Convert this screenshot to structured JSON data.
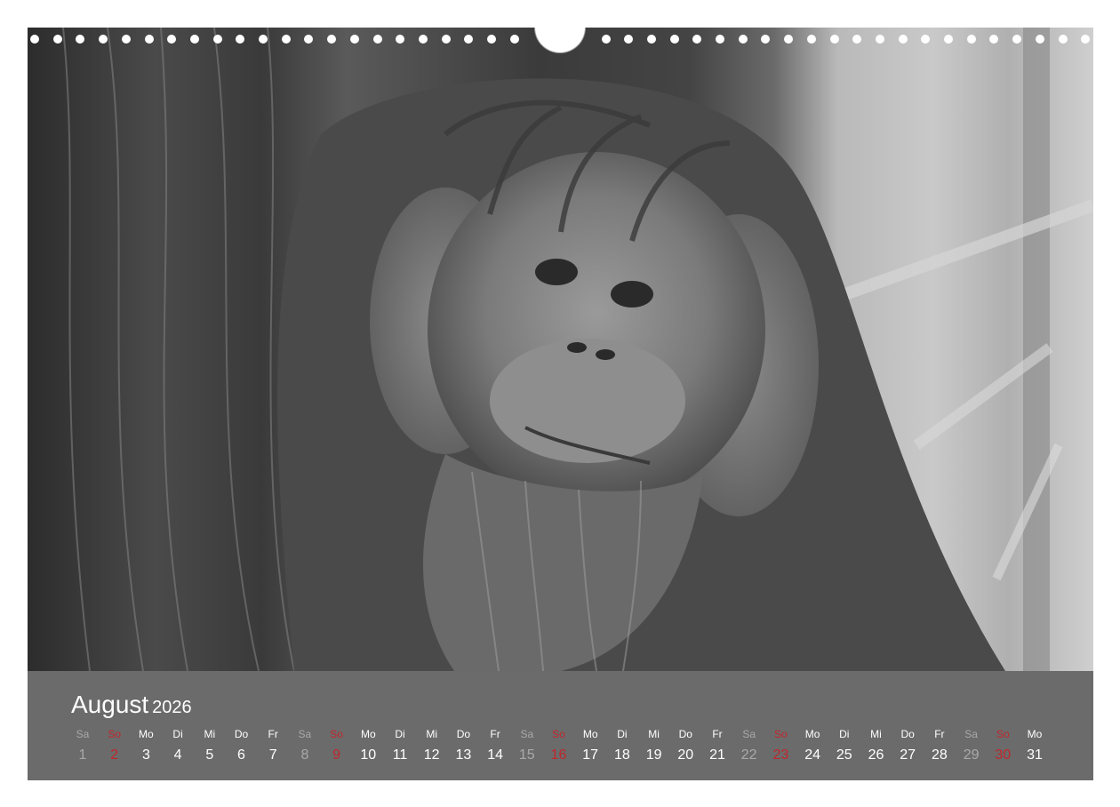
{
  "calendar": {
    "month": "August",
    "year": "2026",
    "photo_subject": "",
    "colors": {
      "bar_background": "#6b6b6b",
      "weekday_text": "#ffffff",
      "saturday_text": "#a9a9a9",
      "sunday_text": "#c0272d"
    },
    "days": [
      {
        "dn": "Sa",
        "n": "1",
        "t": "sat"
      },
      {
        "dn": "So",
        "n": "2",
        "t": "sun"
      },
      {
        "dn": "Mo",
        "n": "3",
        "t": "wd"
      },
      {
        "dn": "Di",
        "n": "4",
        "t": "wd"
      },
      {
        "dn": "Mi",
        "n": "5",
        "t": "wd"
      },
      {
        "dn": "Do",
        "n": "6",
        "t": "wd"
      },
      {
        "dn": "Fr",
        "n": "7",
        "t": "wd"
      },
      {
        "dn": "Sa",
        "n": "8",
        "t": "sat"
      },
      {
        "dn": "So",
        "n": "9",
        "t": "sun"
      },
      {
        "dn": "Mo",
        "n": "10",
        "t": "wd"
      },
      {
        "dn": "Di",
        "n": "11",
        "t": "wd"
      },
      {
        "dn": "Mi",
        "n": "12",
        "t": "wd"
      },
      {
        "dn": "Do",
        "n": "13",
        "t": "wd"
      },
      {
        "dn": "Fr",
        "n": "14",
        "t": "wd"
      },
      {
        "dn": "Sa",
        "n": "15",
        "t": "sat"
      },
      {
        "dn": "So",
        "n": "16",
        "t": "sun"
      },
      {
        "dn": "Mo",
        "n": "17",
        "t": "wd"
      },
      {
        "dn": "Di",
        "n": "18",
        "t": "wd"
      },
      {
        "dn": "Mi",
        "n": "19",
        "t": "wd"
      },
      {
        "dn": "Do",
        "n": "20",
        "t": "wd"
      },
      {
        "dn": "Fr",
        "n": "21",
        "t": "wd"
      },
      {
        "dn": "Sa",
        "n": "22",
        "t": "sat"
      },
      {
        "dn": "So",
        "n": "23",
        "t": "sun"
      },
      {
        "dn": "Mo",
        "n": "24",
        "t": "wd"
      },
      {
        "dn": "Di",
        "n": "25",
        "t": "wd"
      },
      {
        "dn": "Mi",
        "n": "26",
        "t": "wd"
      },
      {
        "dn": "Do",
        "n": "27",
        "t": "wd"
      },
      {
        "dn": "Fr",
        "n": "28",
        "t": "wd"
      },
      {
        "dn": "Sa",
        "n": "29",
        "t": "sat"
      },
      {
        "dn": "So",
        "n": "30",
        "t": "sun"
      },
      {
        "dn": "Mo",
        "n": "31",
        "t": "wd"
      }
    ]
  }
}
